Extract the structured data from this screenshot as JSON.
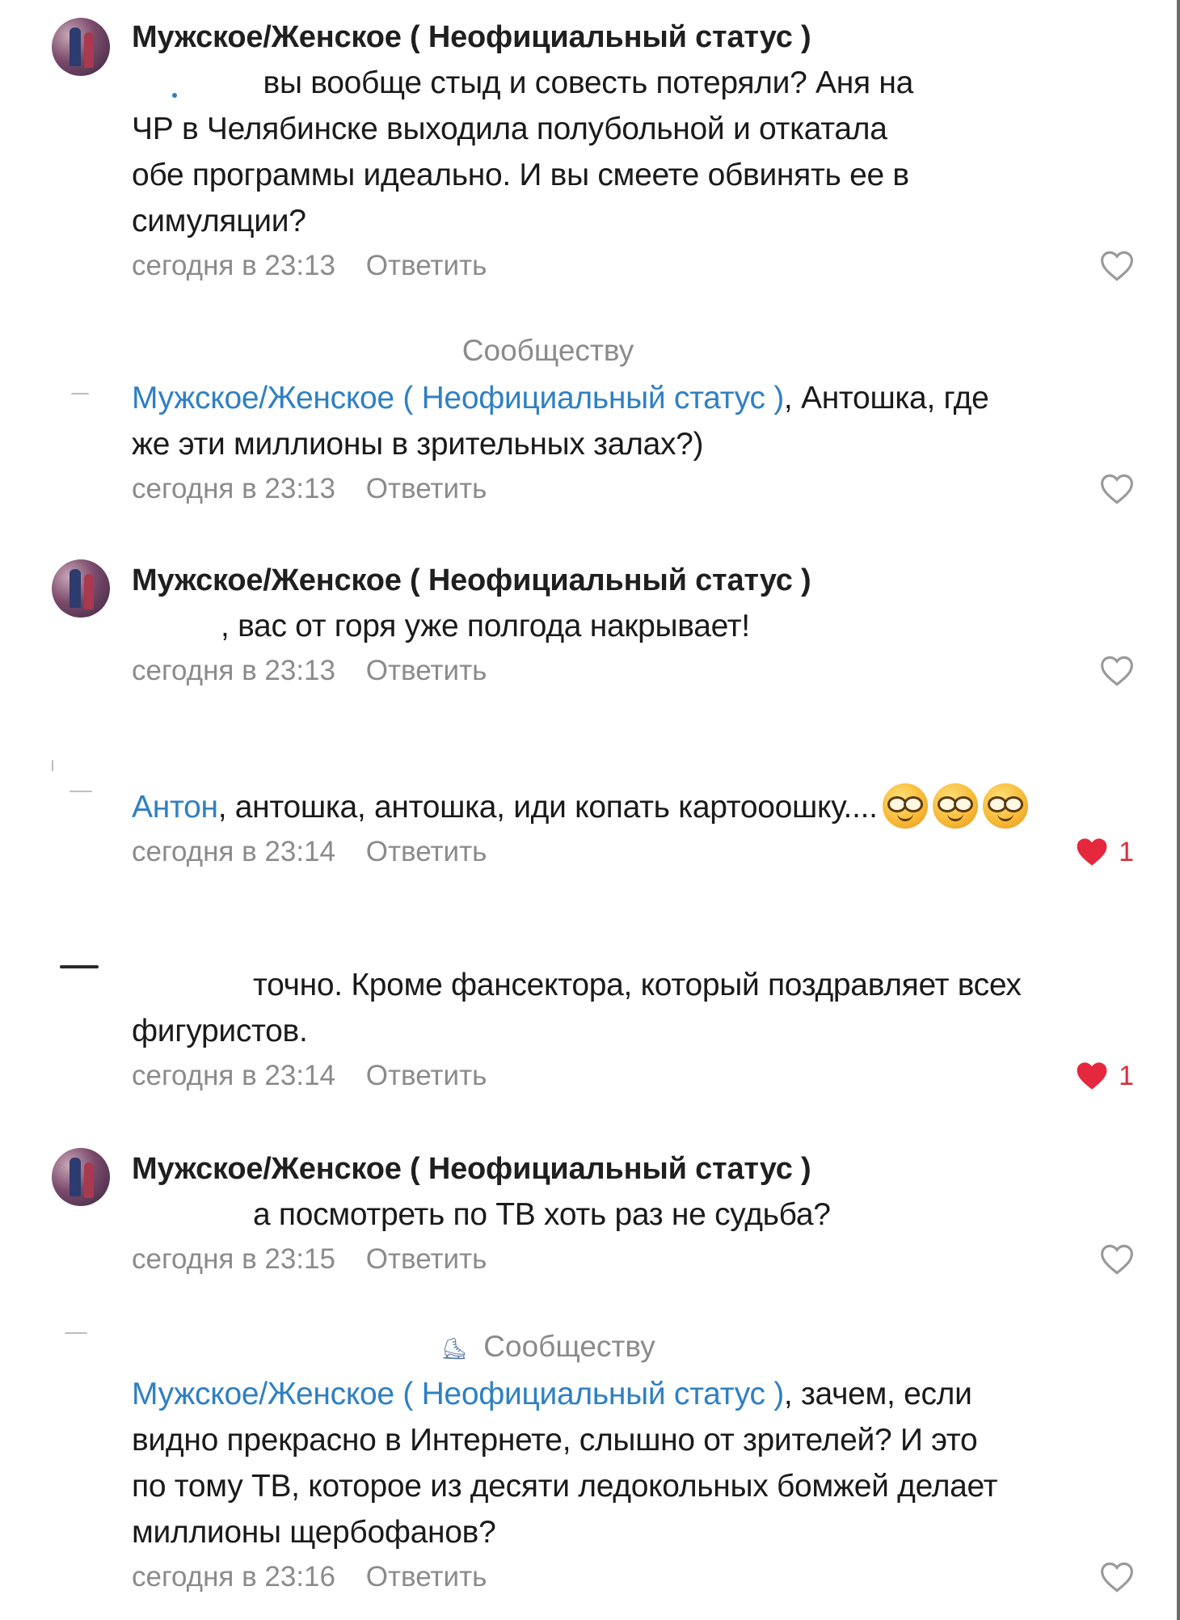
{
  "community_name": "Мужское/Женское ( Неофициальный статус )",
  "reply_label": "Ответить",
  "community_label": "Сообществу",
  "colors": {
    "mention": "#2f80c2",
    "meta": "#8b8b8b",
    "like": "#d32f3f"
  },
  "comments": [
    {
      "author": "Мужское/Женское ( Неофициальный статус )",
      "text_lines": [
        "вы вообще стыд и совесть потеряли? Аня на",
        "ЧР в Челябинске выходила полубольной и откатала",
        "обе программы идеально. И вы смеете обвинять ее в",
        "симуляции?"
      ],
      "time": "сегодня в 23:13",
      "liked": false
    },
    {
      "mention": "Мужское/Женское ( Неофициальный статус )",
      "text_first": ", Антошка, где",
      "text_lines": [
        "же эти миллионы в зрительных залах?)"
      ],
      "time": "сегодня в 23:13",
      "liked": false
    },
    {
      "author": "Мужское/Женское ( Неофициальный статус )",
      "text": ", вас от горя уже полгода накрывает!",
      "time": "сегодня в 23:13",
      "liked": false
    },
    {
      "mention": "Антон",
      "text": ", антошка, антошка, иди копать картооошку....",
      "emoji": [
        "nerd-face-emoji",
        "nerd-face-emoji",
        "nerd-face-emoji"
      ],
      "time": "сегодня в 23:14",
      "liked": true,
      "likes": "1"
    },
    {
      "text_first": "точно. Кроме фансектора, который поздравляет всех",
      "text_lines": [
        "фигуристов."
      ],
      "time": "сегодня в 23:14",
      "liked": true,
      "likes": "1"
    },
    {
      "author": "Мужское/Женское ( Неофициальный статус )",
      "text": "а посмотреть по ТВ хоть раз не судьба?",
      "time": "сегодня в 23:15",
      "liked": false
    },
    {
      "mention": "Мужское/Женское ( Неофициальный статус )",
      "text_first": ", зачем, если",
      "text_lines": [
        "видно прекрасно в Интернете, слышно от зрителей? И это",
        "по тому ТВ, которое из десяти ледокольных бомжей делает",
        "миллионы щербофанов?"
      ],
      "time": "сегодня в 23:16",
      "liked": false
    }
  ]
}
